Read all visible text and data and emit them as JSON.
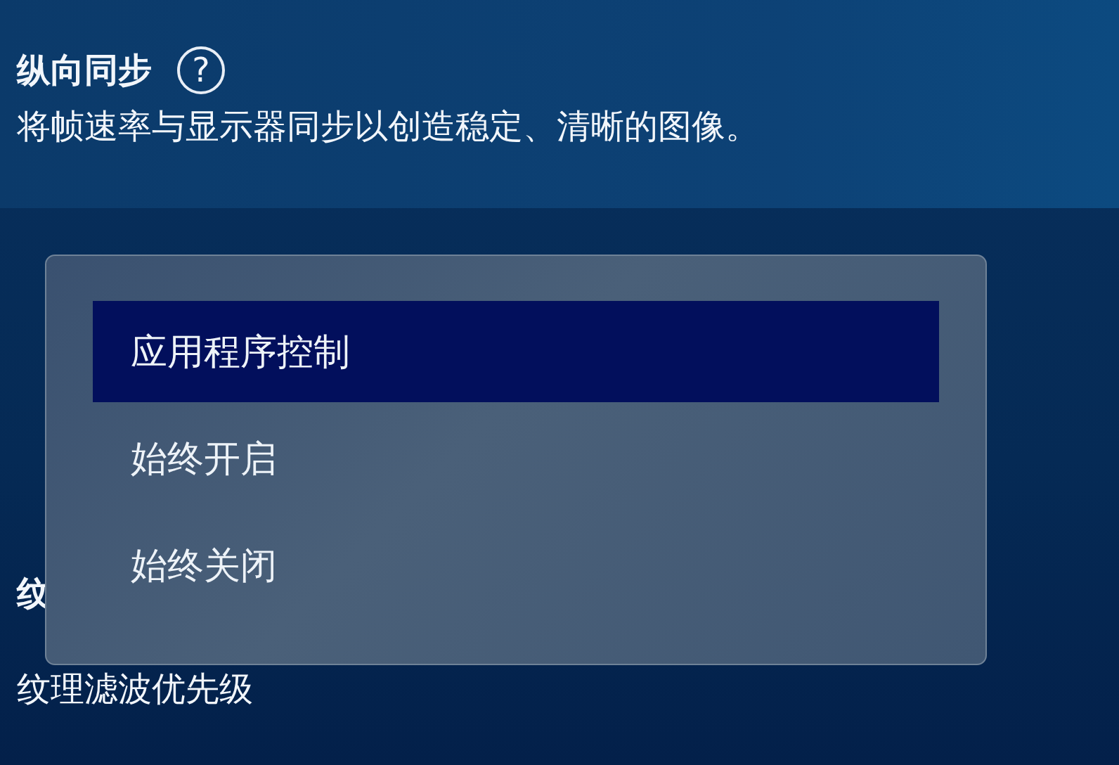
{
  "sections": [
    {
      "title": "纵向同步",
      "help": "?",
      "description": "将帧速率与显示器同步以创造稳定、清晰的图像。"
    },
    {
      "title": "纹",
      "description": "纹理滤波优先级"
    }
  ],
  "dropdown": {
    "options": [
      {
        "label": "应用程序控制",
        "selected": true
      },
      {
        "label": "始终开启",
        "selected": false
      },
      {
        "label": "始终关闭",
        "selected": false
      }
    ]
  }
}
